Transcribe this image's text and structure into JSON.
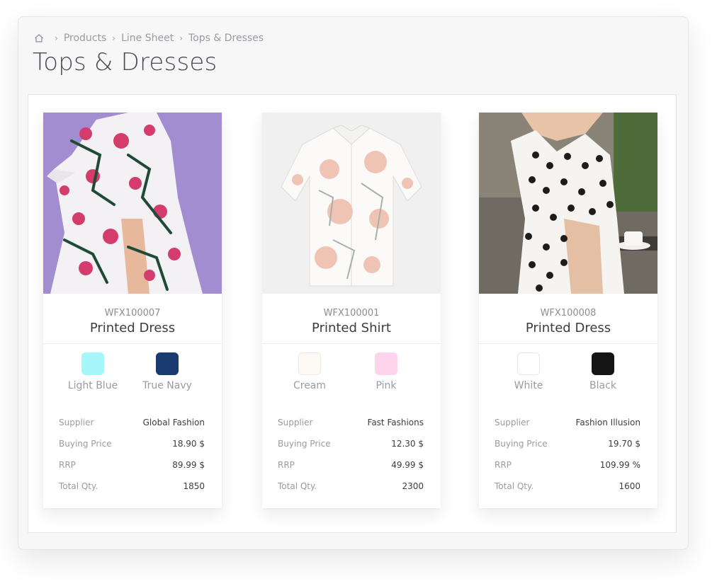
{
  "breadcrumb": {
    "items": [
      "Products",
      "Line Sheet",
      "Tops & Dresses"
    ]
  },
  "page": {
    "title": "Tops & Dresses"
  },
  "spec_labels": {
    "supplier": "Supplier",
    "buying_price": "Buying Price",
    "rrp": "RRP",
    "total_qty": "Total Qty."
  },
  "products": [
    {
      "sku": "WFX100007",
      "name": "Printed Dress",
      "colors": [
        {
          "name": "Light Blue",
          "hex": "#a6f7fb"
        },
        {
          "name": "True Navy",
          "hex": "#1a3a72"
        }
      ],
      "supplier": "Global Fashion",
      "buying_price": "18.90 $",
      "rrp": "89.99 $",
      "total_qty": "1850"
    },
    {
      "sku": "WFX100001",
      "name": "Printed Shirt",
      "colors": [
        {
          "name": "Cream",
          "hex": "#fdfaf5"
        },
        {
          "name": "Pink",
          "hex": "#fdd4ec"
        }
      ],
      "supplier": "Fast Fashions",
      "buying_price": "12.30 $",
      "rrp": "49.99 $",
      "total_qty": "2300"
    },
    {
      "sku": "WFX100008",
      "name": "Printed Dress",
      "colors": [
        {
          "name": "White",
          "hex": "#ffffff"
        },
        {
          "name": "Black",
          "hex": "#141414"
        }
      ],
      "supplier": "Fashion Illusion",
      "buying_price": "19.70 $",
      "rrp": "109.99 %",
      "total_qty": "1600"
    }
  ]
}
